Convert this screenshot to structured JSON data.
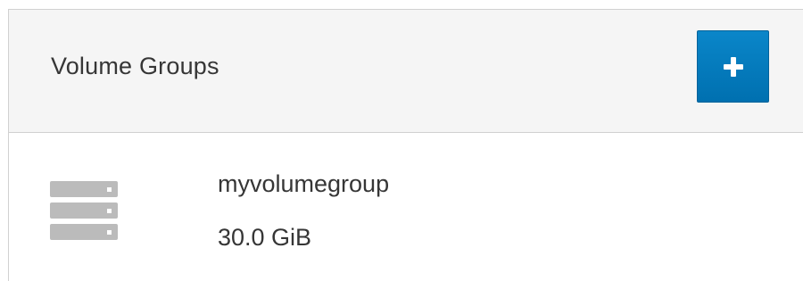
{
  "panel": {
    "title": "Volume Groups",
    "add_button_icon": "plus-icon"
  },
  "volume_groups": [
    {
      "icon": "server-stack-icon",
      "name": "myvolumegroup",
      "size": "30.0 GiB"
    }
  ],
  "colors": {
    "accent": "#0088ce",
    "header_bg": "#f5f5f5",
    "border": "#d1d1d1",
    "text": "#363636",
    "icon_gray": "#bbbbbb"
  }
}
